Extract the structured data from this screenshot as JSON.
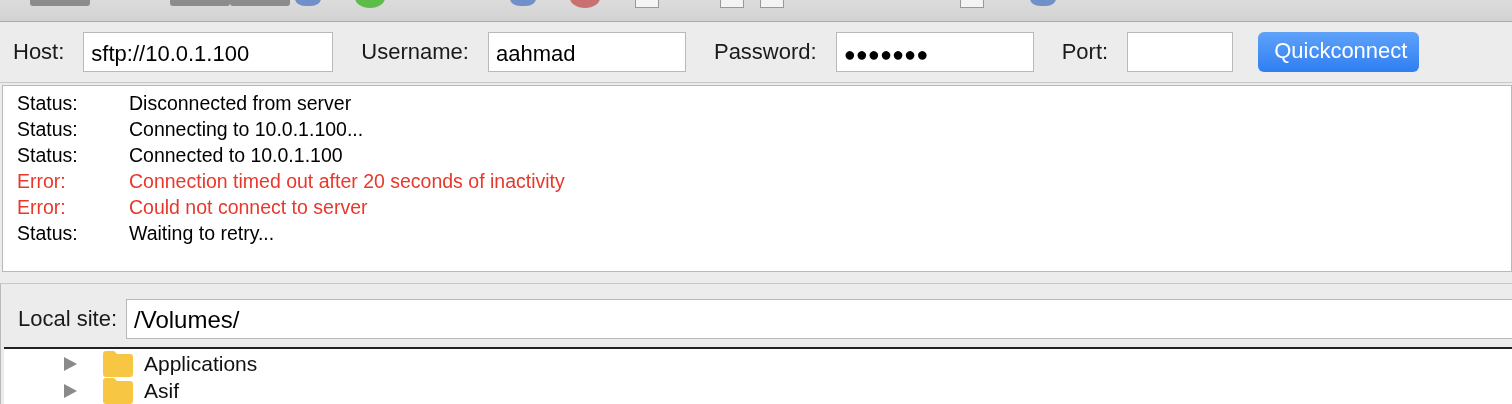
{
  "toolbar": {
    "buttons": [
      {
        "kind": "plain"
      },
      {
        "kind": "plain"
      },
      {
        "kind": "plain"
      },
      {
        "kind": "sync"
      },
      {
        "kind": "green"
      },
      {
        "kind": "arrows"
      },
      {
        "kind": "red"
      },
      {
        "kind": "doc"
      },
      {
        "kind": "doc"
      },
      {
        "kind": "doc"
      },
      {
        "kind": "doc"
      },
      {
        "kind": "binoculars"
      }
    ]
  },
  "quickconnect": {
    "host_label": "Host:",
    "host": "sftp://10.0.1.100",
    "username_label": "Username:",
    "username": "aahmad",
    "password_label": "Password:",
    "password": "●●●●●●●",
    "port_label": "Port:",
    "button": "Quickconnect"
  },
  "log": [
    {
      "kind": "status",
      "label": "Status:",
      "message": "Disconnected from server"
    },
    {
      "kind": "status",
      "label": "Status:",
      "message": "Connecting to 10.0.1.100..."
    },
    {
      "kind": "status",
      "label": "Status:",
      "message": "Connected to 10.0.1.100"
    },
    {
      "kind": "error",
      "label": "Error:",
      "message": "Connection timed out after 20 seconds of inactivity"
    },
    {
      "kind": "error",
      "label": "Error:",
      "message": "Could not connect to server"
    },
    {
      "kind": "status",
      "label": "Status:",
      "message": "Waiting to retry..."
    }
  ],
  "local_site": {
    "label": "Local site:",
    "path": "/Volumes/",
    "items": [
      {
        "name": "Applications",
        "expanded": false
      },
      {
        "name": "Asif",
        "expanded": false
      }
    ]
  }
}
